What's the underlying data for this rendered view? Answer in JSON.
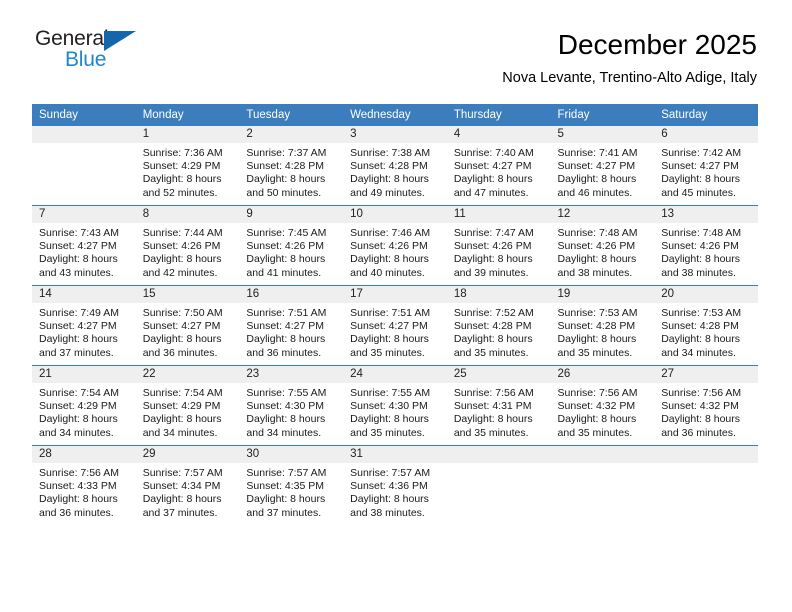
{
  "brand": {
    "name_top": "General",
    "name_bottom": "Blue",
    "triangle_color": "#1366ac",
    "blue_text_color": "#1f86d0"
  },
  "header": {
    "title": "December 2025",
    "subtitle": "Nova Levante, Trentino-Alto Adige, Italy"
  },
  "theme": {
    "header_blue": "#3b7dbd",
    "daynum_band": "#efefef",
    "cell_background": "#ffffff"
  },
  "calendar": {
    "weekday_headers": [
      "Sunday",
      "Monday",
      "Tuesday",
      "Wednesday",
      "Thursday",
      "Friday",
      "Saturday"
    ],
    "weeks": [
      [
        {
          "day": "",
          "lines": []
        },
        {
          "day": "1",
          "lines": [
            "Sunrise: 7:36 AM",
            "Sunset: 4:29 PM",
            "Daylight: 8 hours",
            "and 52 minutes."
          ]
        },
        {
          "day": "2",
          "lines": [
            "Sunrise: 7:37 AM",
            "Sunset: 4:28 PM",
            "Daylight: 8 hours",
            "and 50 minutes."
          ]
        },
        {
          "day": "3",
          "lines": [
            "Sunrise: 7:38 AM",
            "Sunset: 4:28 PM",
            "Daylight: 8 hours",
            "and 49 minutes."
          ]
        },
        {
          "day": "4",
          "lines": [
            "Sunrise: 7:40 AM",
            "Sunset: 4:27 PM",
            "Daylight: 8 hours",
            "and 47 minutes."
          ]
        },
        {
          "day": "5",
          "lines": [
            "Sunrise: 7:41 AM",
            "Sunset: 4:27 PM",
            "Daylight: 8 hours",
            "and 46 minutes."
          ]
        },
        {
          "day": "6",
          "lines": [
            "Sunrise: 7:42 AM",
            "Sunset: 4:27 PM",
            "Daylight: 8 hours",
            "and 45 minutes."
          ]
        }
      ],
      [
        {
          "day": "7",
          "lines": [
            "Sunrise: 7:43 AM",
            "Sunset: 4:27 PM",
            "Daylight: 8 hours",
            "and 43 minutes."
          ]
        },
        {
          "day": "8",
          "lines": [
            "Sunrise: 7:44 AM",
            "Sunset: 4:26 PM",
            "Daylight: 8 hours",
            "and 42 minutes."
          ]
        },
        {
          "day": "9",
          "lines": [
            "Sunrise: 7:45 AM",
            "Sunset: 4:26 PM",
            "Daylight: 8 hours",
            "and 41 minutes."
          ]
        },
        {
          "day": "10",
          "lines": [
            "Sunrise: 7:46 AM",
            "Sunset: 4:26 PM",
            "Daylight: 8 hours",
            "and 40 minutes."
          ]
        },
        {
          "day": "11",
          "lines": [
            "Sunrise: 7:47 AM",
            "Sunset: 4:26 PM",
            "Daylight: 8 hours",
            "and 39 minutes."
          ]
        },
        {
          "day": "12",
          "lines": [
            "Sunrise: 7:48 AM",
            "Sunset: 4:26 PM",
            "Daylight: 8 hours",
            "and 38 minutes."
          ]
        },
        {
          "day": "13",
          "lines": [
            "Sunrise: 7:48 AM",
            "Sunset: 4:26 PM",
            "Daylight: 8 hours",
            "and 38 minutes."
          ]
        }
      ],
      [
        {
          "day": "14",
          "lines": [
            "Sunrise: 7:49 AM",
            "Sunset: 4:27 PM",
            "Daylight: 8 hours",
            "and 37 minutes."
          ]
        },
        {
          "day": "15",
          "lines": [
            "Sunrise: 7:50 AM",
            "Sunset: 4:27 PM",
            "Daylight: 8 hours",
            "and 36 minutes."
          ]
        },
        {
          "day": "16",
          "lines": [
            "Sunrise: 7:51 AM",
            "Sunset: 4:27 PM",
            "Daylight: 8 hours",
            "and 36 minutes."
          ]
        },
        {
          "day": "17",
          "lines": [
            "Sunrise: 7:51 AM",
            "Sunset: 4:27 PM",
            "Daylight: 8 hours",
            "and 35 minutes."
          ]
        },
        {
          "day": "18",
          "lines": [
            "Sunrise: 7:52 AM",
            "Sunset: 4:28 PM",
            "Daylight: 8 hours",
            "and 35 minutes."
          ]
        },
        {
          "day": "19",
          "lines": [
            "Sunrise: 7:53 AM",
            "Sunset: 4:28 PM",
            "Daylight: 8 hours",
            "and 35 minutes."
          ]
        },
        {
          "day": "20",
          "lines": [
            "Sunrise: 7:53 AM",
            "Sunset: 4:28 PM",
            "Daylight: 8 hours",
            "and 34 minutes."
          ]
        }
      ],
      [
        {
          "day": "21",
          "lines": [
            "Sunrise: 7:54 AM",
            "Sunset: 4:29 PM",
            "Daylight: 8 hours",
            "and 34 minutes."
          ]
        },
        {
          "day": "22",
          "lines": [
            "Sunrise: 7:54 AM",
            "Sunset: 4:29 PM",
            "Daylight: 8 hours",
            "and 34 minutes."
          ]
        },
        {
          "day": "23",
          "lines": [
            "Sunrise: 7:55 AM",
            "Sunset: 4:30 PM",
            "Daylight: 8 hours",
            "and 34 minutes."
          ]
        },
        {
          "day": "24",
          "lines": [
            "Sunrise: 7:55 AM",
            "Sunset: 4:30 PM",
            "Daylight: 8 hours",
            "and 35 minutes."
          ]
        },
        {
          "day": "25",
          "lines": [
            "Sunrise: 7:56 AM",
            "Sunset: 4:31 PM",
            "Daylight: 8 hours",
            "and 35 minutes."
          ]
        },
        {
          "day": "26",
          "lines": [
            "Sunrise: 7:56 AM",
            "Sunset: 4:32 PM",
            "Daylight: 8 hours",
            "and 35 minutes."
          ]
        },
        {
          "day": "27",
          "lines": [
            "Sunrise: 7:56 AM",
            "Sunset: 4:32 PM",
            "Daylight: 8 hours",
            "and 36 minutes."
          ]
        }
      ],
      [
        {
          "day": "28",
          "lines": [
            "Sunrise: 7:56 AM",
            "Sunset: 4:33 PM",
            "Daylight: 8 hours",
            "and 36 minutes."
          ]
        },
        {
          "day": "29",
          "lines": [
            "Sunrise: 7:57 AM",
            "Sunset: 4:34 PM",
            "Daylight: 8 hours",
            "and 37 minutes."
          ]
        },
        {
          "day": "30",
          "lines": [
            "Sunrise: 7:57 AM",
            "Sunset: 4:35 PM",
            "Daylight: 8 hours",
            "and 37 minutes."
          ]
        },
        {
          "day": "31",
          "lines": [
            "Sunrise: 7:57 AM",
            "Sunset: 4:36 PM",
            "Daylight: 8 hours",
            "and 38 minutes."
          ]
        },
        {
          "day": "",
          "lines": []
        },
        {
          "day": "",
          "lines": []
        },
        {
          "day": "",
          "lines": []
        }
      ]
    ]
  }
}
